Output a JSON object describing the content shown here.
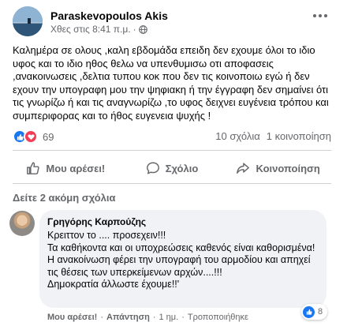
{
  "post": {
    "author": "Paraskevopoulos Akis",
    "timestamp": "Χθες στις 8:41 π.μ.",
    "separator": "·",
    "privacy_icon": "globe-icon",
    "text": "Καλημέρα σε ολους ,καλη εβδομάδα επειδη δεν εχουμε όλοι το ιδιο υφος και το ιδιο ηθος θελω να υπενθυμισω οτι αποφασεις ,ανακοινωσεις ,δελτια τυπου κοκ που δεν τις κοινοποιω εγώ ή δεν εχουν την υπογραφη μου την ψηφιακη ή την έγγραφη δεν σημαίνει ότι τις γνωρίζω ή και τις αναγνωρίζω ,το υφος δειχνει ευγένεια τρόπου και συμπεριφορας  και το ήθος ευγενεια ψυχής  !"
  },
  "stats": {
    "reaction_count": "69",
    "comments": "10 σχόλια",
    "shares": "1 κοινοποίηση"
  },
  "actions": {
    "like": "Μου αρέσει!",
    "comment": "Σχόλιο",
    "share": "Κοινοποίηση"
  },
  "more_comments": "Δείτε 2 ακόμη σχόλια",
  "comment": {
    "author": "Γρηγόρης Καρπούζης",
    "text": "Κρειττον το .... προσεχειν!!!\nΤα καθήκοντα και οι υποχρεώσεις καθενός είναι καθορισμένα!\nΗ ανακοίνωση φέρει την υπογραφή του αρμοδίου και απηχεί τις θέσεις των υπερκείμενων αρχών....!!!\nΔημοκρατία άλλωστε έχουμε!!'",
    "reaction_count": "8",
    "like_label": "Μου αρέσει!",
    "reply_label": "Απάντηση",
    "age": "1 ημ.",
    "edited": "Τροποποιήθηκε",
    "dot": "·"
  },
  "colors": {
    "like_blue": "#1877f2",
    "love_red": "#f33e58",
    "secondary_text": "#65676b",
    "bubble_bg": "#f0f2f5"
  }
}
